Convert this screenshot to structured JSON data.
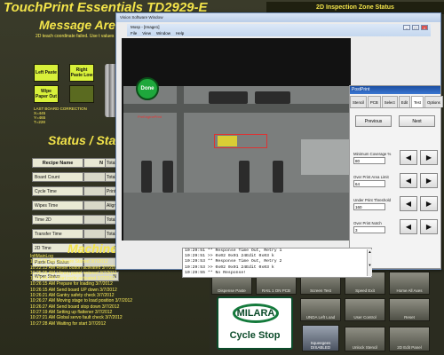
{
  "app": {
    "title": "TouchPrint Essentials TD2929-E"
  },
  "message_area": {
    "heading": "Message Area/Sta",
    "text": "2D teach coordinate failed.  Use t values"
  },
  "inspection_zone": {
    "heading": "2D Inspection Zone Status"
  },
  "machine_buttons": [
    {
      "label": "Left Paste"
    },
    {
      "label": "Right Paste Low"
    },
    {
      "label": "Wipe Paper Out"
    },
    {
      "label": ""
    }
  ],
  "board_correction": {
    "label": "LAST BOARD CORRECTION",
    "lines": [
      "X=445",
      "Y=465",
      "T=228"
    ]
  },
  "status": {
    "heading": "Status / Stas",
    "header_label": "Recipe Name",
    "header_value": "N",
    "rows": [
      {
        "label": "Board Count",
        "value": "0"
      },
      {
        "label": "Cycle Time",
        "value": "0"
      },
      {
        "label": "Wipes Time",
        "value": "0"
      },
      {
        "label": "Time 2D",
        "value": "0"
      },
      {
        "label": "Transfer Time",
        "value": "5.616"
      },
      {
        "label": "2D Time",
        "value": "0"
      },
      {
        "label": "Paste Dsp Status",
        "value": ""
      },
      {
        "label": "Wiper Status",
        "value": "N"
      }
    ],
    "side_labels": [
      "Total",
      "Total",
      "Print",
      "Align",
      "Total",
      "Total"
    ]
  },
  "machine_log": {
    "heading": "Machine",
    "title": "InfiMainLog",
    "entries": [
      "10:31:28 AM Software Started 3/7/2012",
      "10:22:13 AM Reset button activated 3/7/2012",
      "10:25:25 AM Library panel entered 3/7/2012",
      "10:25:44 AM Start cycle activated 3/7/2012",
      "10:26:15 AM Prepare for loading 3/7/2012",
      "10:26:15 AM Send board UP down 3/7/2012",
      "10:26:21 AM Gantry safety check 3/7/2012",
      "10:26:27 AM Moving stage to load position 3/7/2012",
      "10:26:27 AM Send board stop down 3/7/2012",
      "10:27:19 AM Setting up flattener 3/7/2012",
      "10:27:21 AM Global servo fault check 3/7/2012",
      "10:27:28 AM Waiting for start 3/7/2012"
    ]
  },
  "vision_window": {
    "title": "Vision Software Window",
    "subwindow_title": "Mosp - [Image1]",
    "menu": [
      "File",
      "View",
      "Window",
      "Help"
    ],
    "done_label": "Done",
    "overlay_text": "PreEnginePrint",
    "log_lines": [
      "10:29:51 ** Response Time Out, Retry 1",
      "10:29:51 >> 0x02 0x01 24Edit 0x03 k",
      "10:29:53 ** Response Time Out, Retry 2",
      "10:29:53 >> 0x02 0x01 24Edit 0x03 k",
      "10:29:55 ** No Response!"
    ]
  },
  "post_print_panel": {
    "title": "PostPrint",
    "tabs": [
      "Stencil",
      "PCB",
      "Select",
      "Edit",
      "Test",
      "Options"
    ],
    "active_tab": "Test",
    "previous_label": "Previous",
    "next_label": "Next",
    "params": [
      {
        "label": "Minimum Coverage %",
        "value": "80"
      },
      {
        "label": "Over Print Area Limit",
        "value": "64"
      },
      {
        "label": "Under Print Threshold",
        "value": "160"
      },
      {
        "label": "Over Print Notch",
        "value": "3"
      }
    ],
    "left_arrow": "◀",
    "right_arrow": "▶"
  },
  "bottom_tiles": [
    {
      "label": "Dispense Paste"
    },
    {
      "label": "RAIL 1 ON PCB"
    },
    {
      "label": "Screen Test"
    },
    {
      "label": "Speed Exit"
    },
    {
      "label": "Home All Axes"
    },
    {
      "label": "UNDA Left Load"
    },
    {
      "label": "User Control"
    },
    {
      "label": "Reset"
    },
    {
      "label": "Unlock Stencil"
    },
    {
      "label": "2D Edit Panel"
    }
  ],
  "cycle_stop": {
    "logo": "MILARA",
    "label": "Cycle Stop"
  },
  "squeegee": {
    "label": "Squeegees",
    "status": "DISABLED"
  }
}
